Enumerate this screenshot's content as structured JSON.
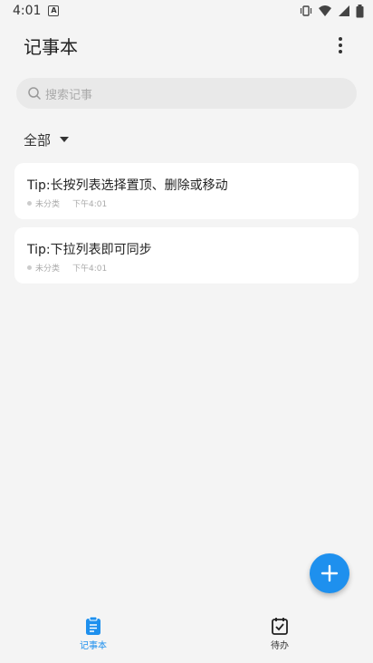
{
  "status_bar": {
    "time": "4:01",
    "app_badge": "A"
  },
  "app_bar": {
    "title": "记事本"
  },
  "search": {
    "placeholder": "搜索记事"
  },
  "filter": {
    "label": "全部"
  },
  "notes": [
    {
      "title": "Tip:长按列表选择置顶、删除或移动",
      "category": "未分类",
      "time": "下午4:01"
    },
    {
      "title": "Tip:下拉列表即可同步",
      "category": "未分类",
      "time": "下午4:01"
    }
  ],
  "bottom_nav": [
    {
      "label": "记事本",
      "icon": "notebook-icon",
      "active": true
    },
    {
      "label": "待办",
      "icon": "todo-check-icon",
      "active": false
    }
  ],
  "colors": {
    "accent": "#1e90ee",
    "background": "#f4f4f4",
    "card": "#ffffff"
  }
}
